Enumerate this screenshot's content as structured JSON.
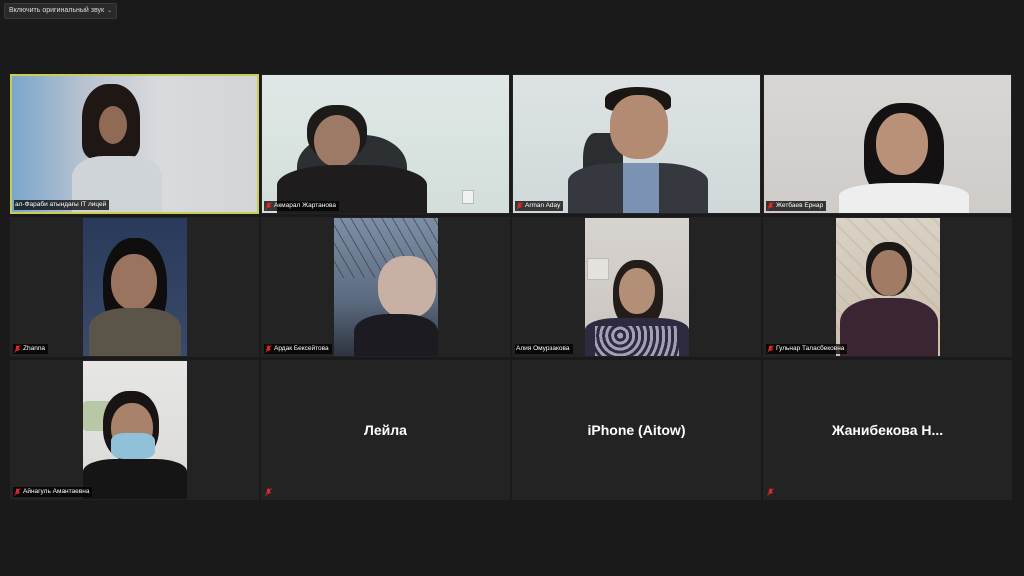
{
  "top_button": {
    "label": "Включить оригинальный звук"
  },
  "participants": [
    {
      "name": "ал-Фараби атындағы IT лицей",
      "muted": false
    },
    {
      "name": "Акмарал Жартанова",
      "muted": true
    },
    {
      "name": "Arman Aday",
      "muted": true
    },
    {
      "name": "Жетбаев Ернар",
      "muted": true
    },
    {
      "name": "Zhanna",
      "muted": true
    },
    {
      "name": "Ардак Бексейтова",
      "muted": true
    },
    {
      "name": "Алия Омурзакова",
      "muted": false
    },
    {
      "name": "Гульнар Таласбековна",
      "muted": true
    },
    {
      "name": "Айнагуль Амантаевна",
      "muted": true
    },
    {
      "name": "",
      "display_name": "Лейла",
      "muted": true
    },
    {
      "name": "",
      "display_name": "iPhone (Aitow)",
      "muted": false
    },
    {
      "name": "",
      "display_name": "Жанибекова  Н...",
      "muted": true
    }
  ],
  "colors": {
    "active_speaker_border": "#c9cd56",
    "mute_icon": "#e02828",
    "tile_bg": "#232323"
  }
}
